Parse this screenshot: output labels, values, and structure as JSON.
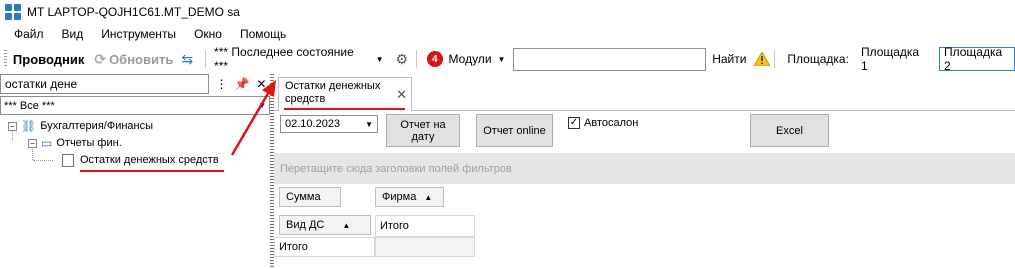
{
  "window": {
    "title": "MT LAPTOP-QOJH1C61.MT_DEMO sa"
  },
  "menu": [
    "Файл",
    "Вид",
    "Инструменты",
    "Окно",
    "Помощь"
  ],
  "toolbar": {
    "explorer_label": "Проводник",
    "refresh_label": "Обновить",
    "state_value": "*** Последнее состояние ***",
    "badge_count": "4",
    "modules_label": "Модули",
    "search_value": "",
    "find_label": "Найти",
    "area_label": "Площадка:",
    "area1_label": "Площадка 1",
    "area2_label": "Площадка 2"
  },
  "left_panel": {
    "search_value": "остатки дене",
    "filter_value": "*** Все ***",
    "tree": {
      "root_label": "Бухгалтерия/Финансы",
      "child_label": "Отчеты фин.",
      "leaf_label": "Остатки денежных средств"
    }
  },
  "tab": {
    "label": "Остатки денежных средств"
  },
  "form": {
    "date_value": "02.10.2023",
    "report_on_date_label": "Отчет на дату",
    "report_online_label": "Отчет online",
    "checkbox_label": "Автосалон",
    "checkbox_checked": true,
    "excel_label": "Excel"
  },
  "pivot": {
    "drop_hint": "Перетащите сюда заголовки полей фильтров",
    "data_field": "Сумма",
    "column_field": "Фирма",
    "row_field": "Вид ДС",
    "col_total": "Итого",
    "row_total": "Итого"
  },
  "colors": {
    "accent": "#2f78c4",
    "badge": "#d0161b",
    "annotation": "#e01414"
  }
}
